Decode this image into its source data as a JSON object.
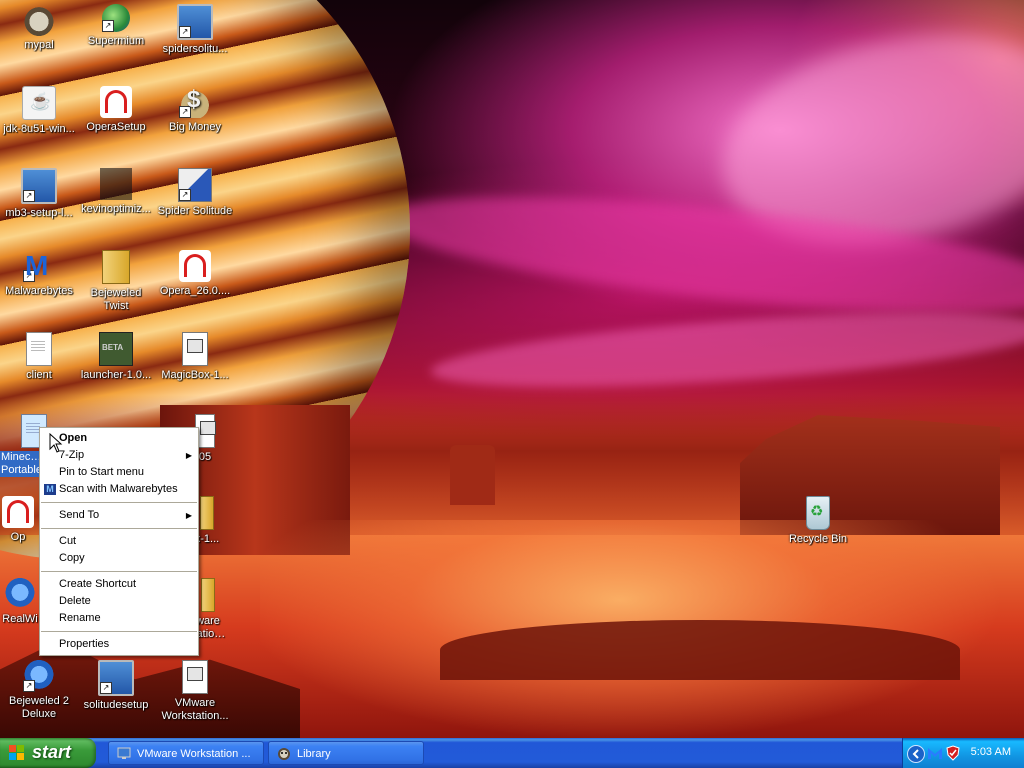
{
  "desktop": {
    "icons": [
      {
        "label": "mypal",
        "icon": "raccoon-icon"
      },
      {
        "label": "Supermium",
        "icon": "globe-icon"
      },
      {
        "label": "spidersolitu...",
        "icon": "installer-icon"
      },
      {
        "label": "jdk-8u51-win...",
        "icon": "java-icon"
      },
      {
        "label": "OperaSetup",
        "icon": "opera-icon"
      },
      {
        "label": "Big Money",
        "icon": "money-bag-icon"
      },
      {
        "label": "mb3-setup-l...",
        "icon": "installer-icon"
      },
      {
        "label": "kevinoptimiz...",
        "icon": "app-icon"
      },
      {
        "label": "Spider Solitude",
        "icon": "spider-cards-icon"
      },
      {
        "label": "Malwarebytes",
        "icon": "malwarebytes-icon"
      },
      {
        "label": "Bejeweled Twist",
        "icon": "zip-icon"
      },
      {
        "label": "Opera_26.0....",
        "icon": "opera-icon"
      },
      {
        "label": "client",
        "icon": "document-icon"
      },
      {
        "label": "launcher-1.0...",
        "icon": "minecraft-beta-icon"
      },
      {
        "label": "MagicBox-1...",
        "icon": "window-file-icon"
      },
      {
        "label": "Minecraft Portable",
        "icon": "document-icon"
      },
      {
        "label": "05",
        "icon": "app-icon"
      },
      {
        "label": "Op",
        "icon": "app-icon"
      },
      {
        "label": "x-1...",
        "icon": "zip-icon"
      },
      {
        "label": "RealWi",
        "icon": "app-icon"
      },
      {
        "label": "ware station...",
        "icon": "zip-icon"
      },
      {
        "label": "Bejeweled 2 Deluxe",
        "icon": "bejeweled-icon"
      },
      {
        "label": "solitudesetup",
        "icon": "installer-icon"
      },
      {
        "label": "VMware Workstation...",
        "icon": "window-file-icon"
      },
      {
        "label": "Recycle Bin",
        "icon": "recycle-bin-icon"
      }
    ]
  },
  "context_menu": {
    "open": "Open",
    "zip": "7-Zip",
    "pin": "Pin to Start menu",
    "scan": "Scan with Malwarebytes",
    "send_to": "Send To",
    "cut": "Cut",
    "copy": "Copy",
    "create_shortcut": "Create Shortcut",
    "delete": "Delete",
    "rename": "Rename",
    "properties": "Properties"
  },
  "taskbar": {
    "start_label": "start",
    "tasks": [
      {
        "label": "VMware Workstation ...",
        "icon": "installer-icon"
      },
      {
        "label": "Library",
        "icon": "raccoon-icon"
      }
    ],
    "clock": "5:03 AM"
  }
}
